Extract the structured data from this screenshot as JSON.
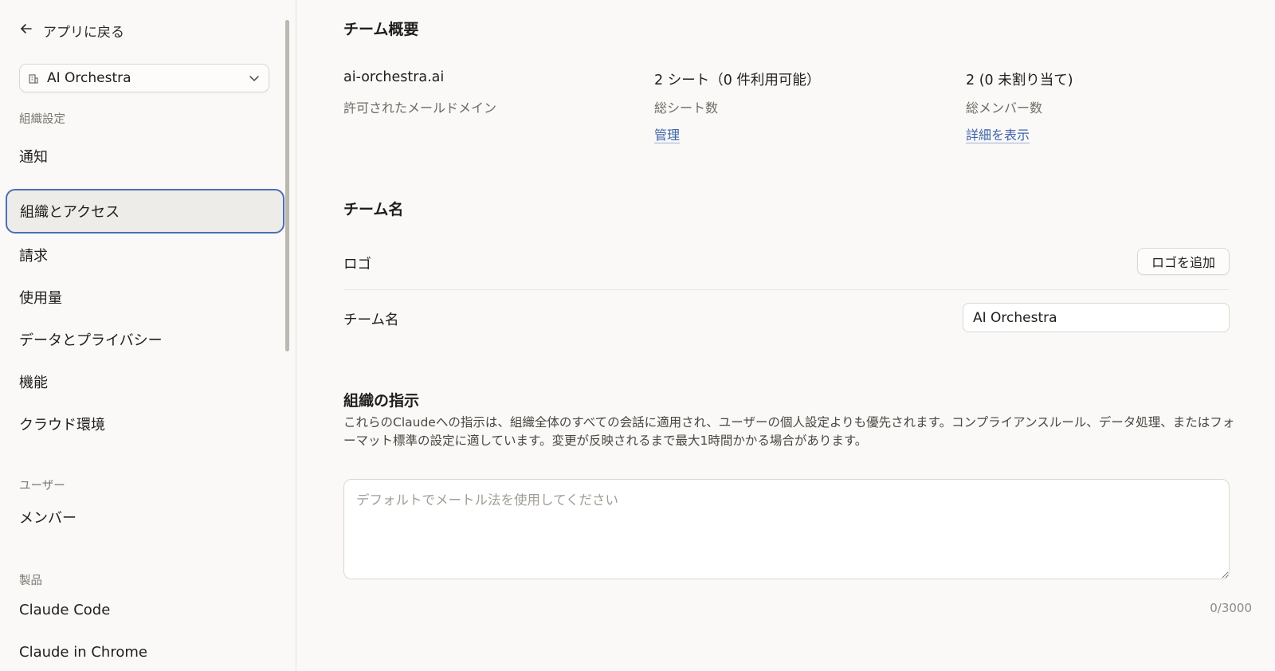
{
  "sidebar": {
    "back_label": "アプリに戻る",
    "org_name": "AI Orchestra",
    "sections": {
      "org_settings": "組織設定",
      "users": "ユーザー",
      "products": "製品"
    },
    "items": {
      "notifications": "通知",
      "org_access": "組織とアクセス",
      "billing": "請求",
      "usage": "使用量",
      "data_privacy": "データとプライバシー",
      "features": "機能",
      "cloud_env": "クラウド環境",
      "members": "メンバー",
      "claude_code": "Claude Code",
      "claude_chrome": "Claude in Chrome"
    },
    "active_item": "組織とアクセス"
  },
  "overview": {
    "title": "チーム概要",
    "domain_value": "ai-orchestra.ai",
    "domain_label": "許可されたメールドメイン",
    "seats_value": "2 シート（0 件利用可能）",
    "seats_label": "総シート数",
    "seats_link": "管理",
    "members_value": "2 (0 未割り当て)",
    "members_label": "総メンバー数",
    "members_link": "詳細を表示"
  },
  "team_name": {
    "title": "チーム名",
    "logo_label": "ロゴ",
    "logo_button": "ロゴを追加",
    "name_label": "チーム名",
    "name_value": "AI Orchestra"
  },
  "instructions": {
    "title": "組織の指示",
    "description": "これらのClaudeへの指示は、組織全体のすべての会話に適用され、ユーザーの個人設定よりも優先されます。コンプライアンスルール、データ処理、またはフォーマット標準の設定に適しています。変更が反映されるまで最大1時間かかる場合があります。",
    "placeholder": "デフォルトでメートル法を使用してください",
    "value": "",
    "counter": "0/3000"
  },
  "colors": {
    "accent": "#4a6fb5",
    "link": "#3e63a8",
    "background": "#faf9f7"
  }
}
